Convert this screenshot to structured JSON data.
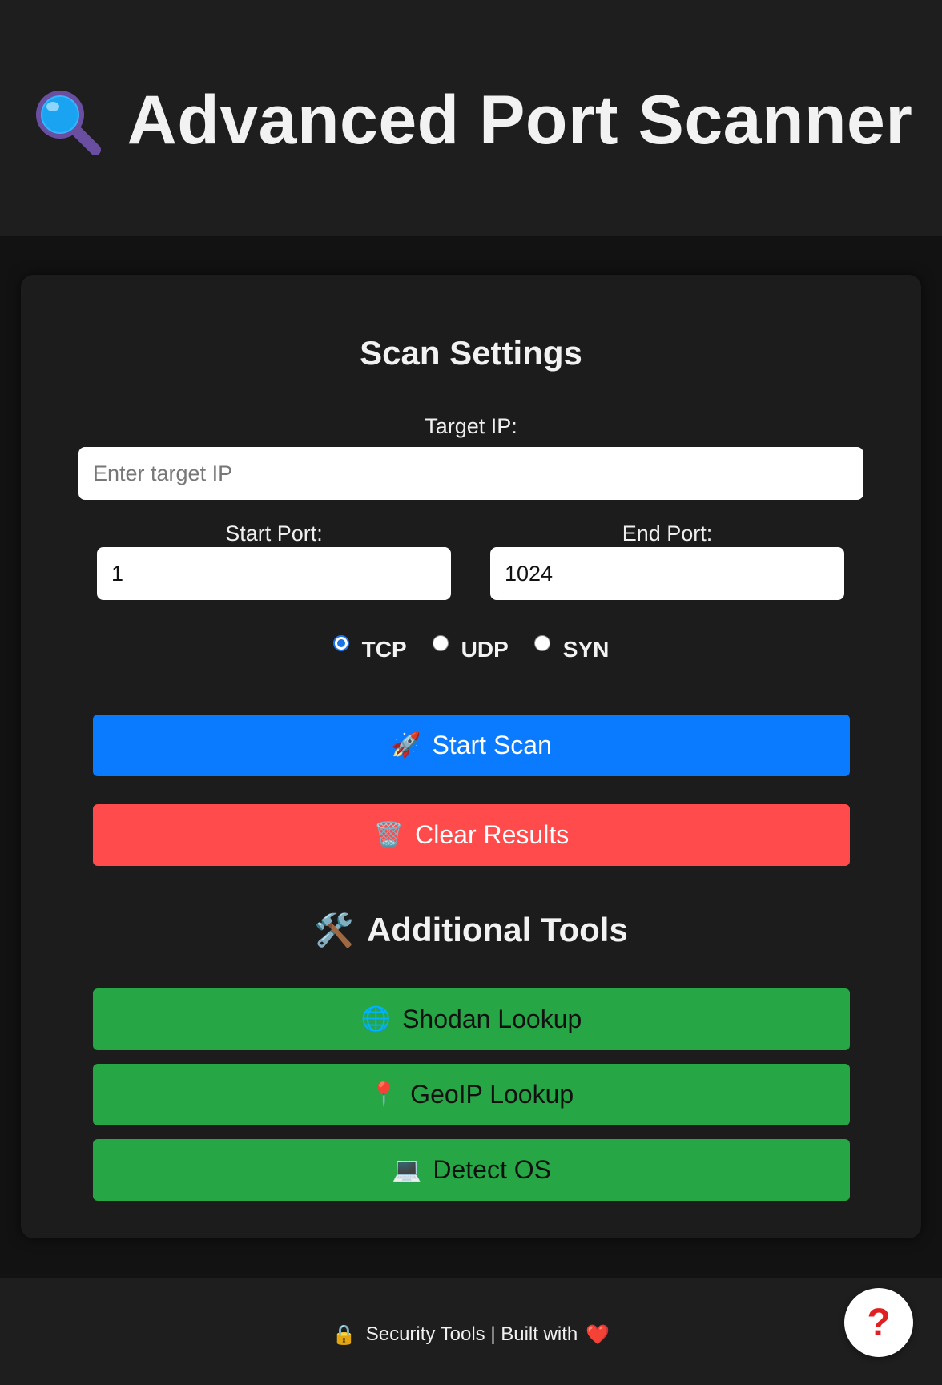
{
  "header": {
    "title": "Advanced Port Scanner",
    "icon": "magnifying-glass-icon"
  },
  "scan_settings": {
    "title": "Scan Settings",
    "target_ip": {
      "label": "Target IP:",
      "placeholder": "Enter target IP",
      "value": ""
    },
    "start_port": {
      "label": "Start Port:",
      "value": "1"
    },
    "end_port": {
      "label": "End Port:",
      "value": "1024"
    },
    "protocols": [
      {
        "label": "TCP",
        "checked": true
      },
      {
        "label": "UDP",
        "checked": false
      },
      {
        "label": "SYN",
        "checked": false
      }
    ],
    "start_button": {
      "label": "Start Scan",
      "icon": "🚀",
      "color": "#0a7bff"
    },
    "clear_button": {
      "label": "Clear Results",
      "icon": "🗑️",
      "color": "#ff4b4b"
    }
  },
  "tools": {
    "title": "Additional Tools",
    "icon": "🛠️",
    "buttons": [
      {
        "label": "Shodan Lookup",
        "icon": "🌐"
      },
      {
        "label": "GeoIP Lookup",
        "icon": "📍"
      },
      {
        "label": "Detect OS",
        "icon": "💻"
      }
    ],
    "color": "#26a644"
  },
  "footer": {
    "icon": "🔒",
    "text": "Security Tools | Built with",
    "heart": "❤️"
  },
  "help_button": {
    "label": "?"
  }
}
